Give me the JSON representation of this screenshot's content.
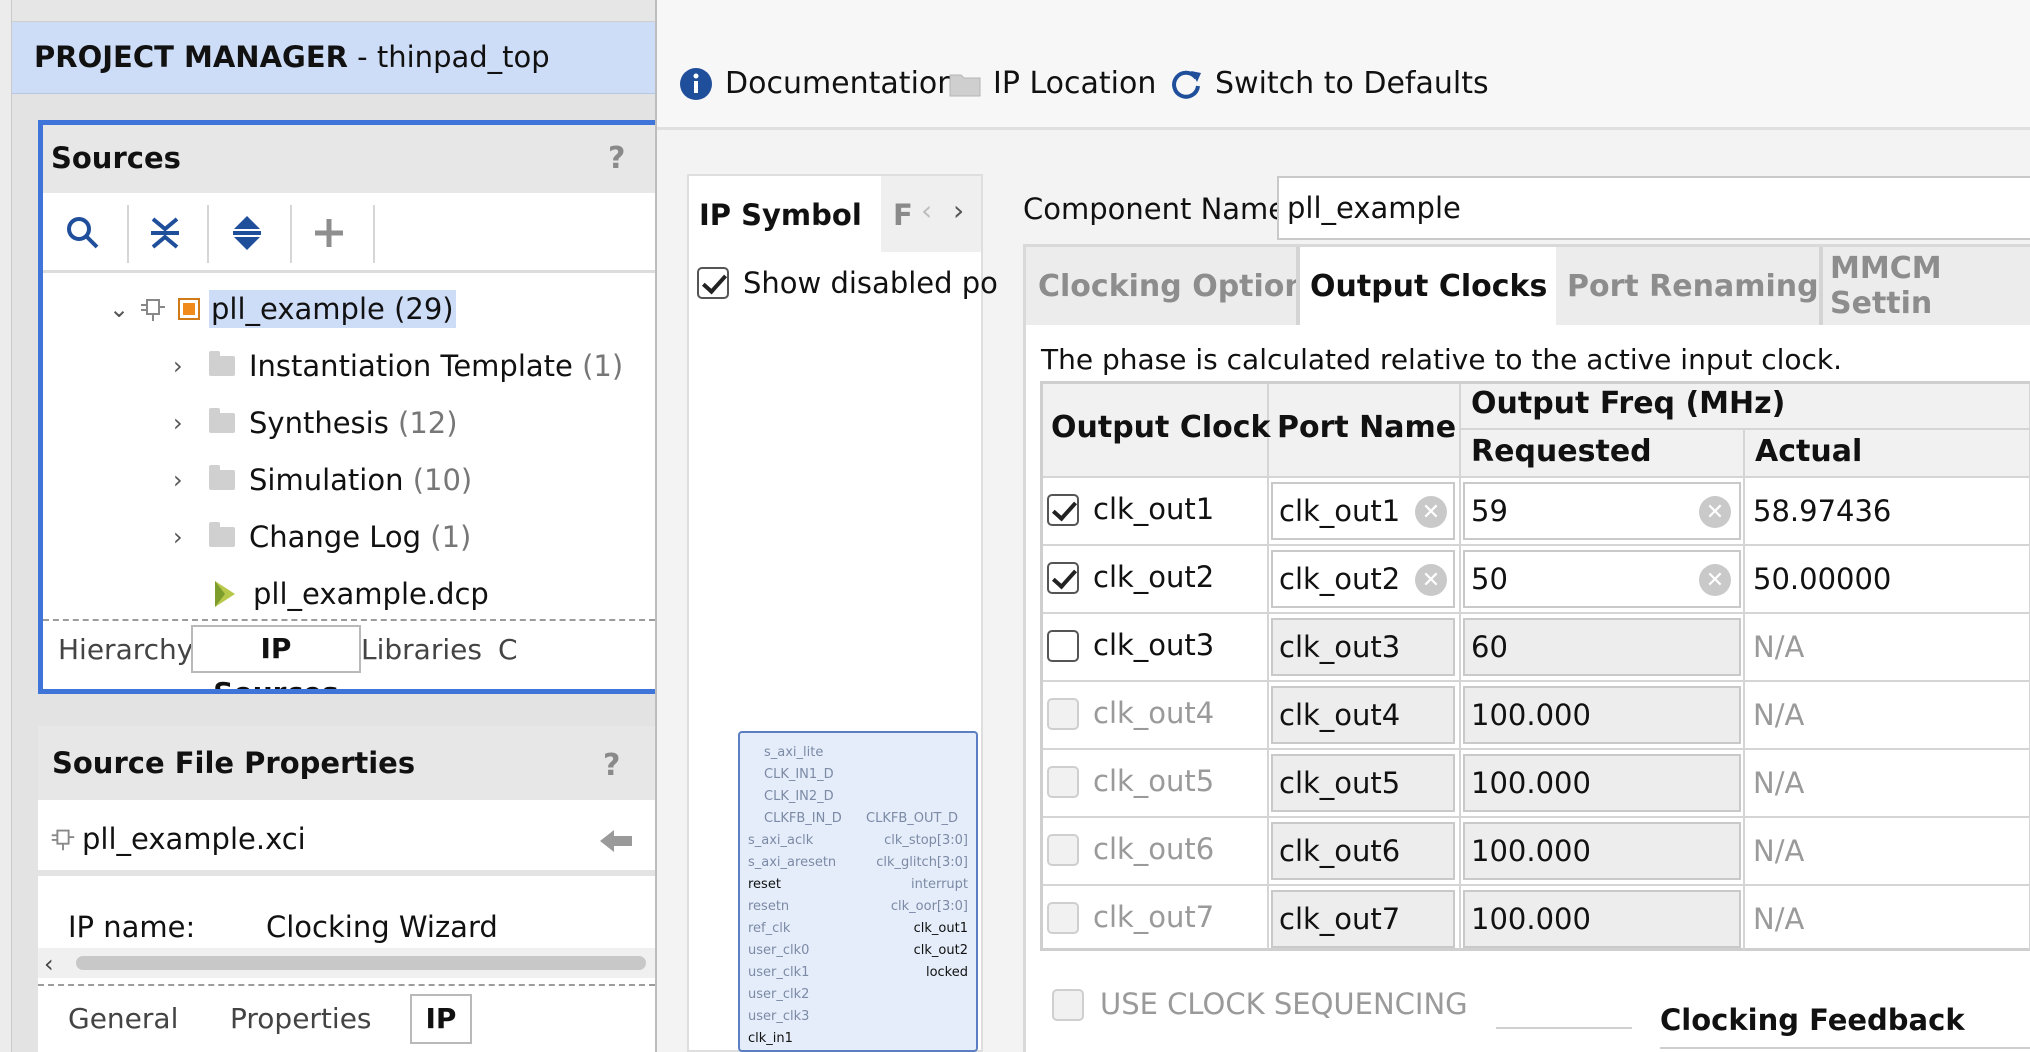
{
  "left": {
    "header": {
      "title": "PROJECT MANAGER",
      "sep": " - ",
      "project": "thinpad_top"
    },
    "sources": {
      "title": "Sources",
      "help": "?",
      "root": {
        "label": "pll_example",
        "count": "(29)"
      },
      "items": [
        {
          "label": "Instantiation Template",
          "count": "(1)"
        },
        {
          "label": "Synthesis",
          "count": "(12)"
        },
        {
          "label": "Simulation",
          "count": "(10)"
        },
        {
          "label": "Change Log",
          "count": "(1)"
        }
      ],
      "dcp": "pll_example.dcp",
      "tabs": [
        "Hierarchy",
        "IP Sources",
        "Libraries",
        "C"
      ]
    },
    "source_file_properties": {
      "title": "Source File Properties",
      "help": "?",
      "file": "pll_example.xci",
      "ip_name_label": "IP name:",
      "ip_name_value": "Clocking Wizard",
      "tabs": [
        "General",
        "Properties",
        "IP"
      ]
    }
  },
  "right": {
    "toolbar": {
      "documentation": "Documentation",
      "ip_location": "IP Location",
      "switch_defaults": "Switch to Defaults"
    },
    "ip_symbol": {
      "tab": "IP Symbol",
      "tab2": "F",
      "show_disabled": "Show disabled po",
      "pins_left": [
        "s_axi_lite",
        "CLK_IN1_D",
        "CLK_IN2_D",
        "CLKFB_IN_D",
        "s_axi_aclk",
        "s_axi_aresetn",
        "reset",
        "resetn",
        "ref_clk",
        "user_clk0",
        "user_clk1",
        "user_clk2",
        "user_clk3",
        "clk_in1"
      ],
      "pins_right": [
        "CLKFB_OUT_D",
        "clk_stop[3:0]",
        "clk_glitch[3:0]",
        "interrupt",
        "clk_oor[3:0]",
        "clk_out1",
        "clk_out2",
        "locked"
      ]
    },
    "component_name_label": "Component Name",
    "component_name": "pll_example",
    "tabs": [
      "Clocking Options",
      "Output Clocks",
      "Port Renaming",
      "MMCM Settin"
    ],
    "note": "The phase is calculated relative to the active input clock.",
    "table": {
      "col_output_clock": "Output Clock",
      "col_port_name": "Port Name",
      "col_freq": "Output Freq (MHz)",
      "col_requested": "Requested",
      "col_actual": "Actual",
      "rows": [
        {
          "clock": "clk_out1",
          "port": "clk_out1",
          "requested": "59",
          "actual": "58.97436"
        },
        {
          "clock": "clk_out2",
          "port": "clk_out2",
          "requested": "50",
          "actual": "50.00000"
        },
        {
          "clock": "clk_out3",
          "port": "clk_out3",
          "requested": "60",
          "actual": "N/A"
        },
        {
          "clock": "clk_out4",
          "port": "clk_out4",
          "requested": "100.000",
          "actual": "N/A"
        },
        {
          "clock": "clk_out5",
          "port": "clk_out5",
          "requested": "100.000",
          "actual": "N/A"
        },
        {
          "clock": "clk_out6",
          "port": "clk_out6",
          "requested": "100.000",
          "actual": "N/A"
        },
        {
          "clock": "clk_out7",
          "port": "clk_out7",
          "requested": "100.000",
          "actual": "N/A"
        }
      ]
    },
    "use_clock_sequencing": "USE CLOCK SEQUENCING",
    "clocking_feedback": "Clocking Feedback"
  }
}
